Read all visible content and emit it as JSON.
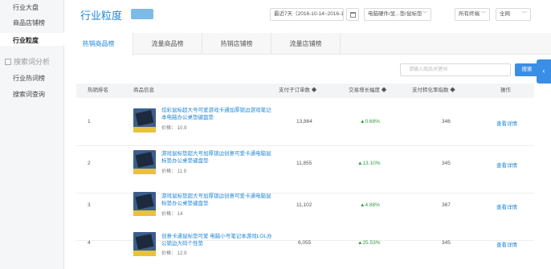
{
  "sidebar": {
    "items": [
      {
        "label": "行业大盘"
      },
      {
        "label": "商品店铺榜"
      },
      {
        "label": "行业粒度"
      }
    ],
    "group_label": "搜索词分析",
    "sub_items": [
      {
        "label": "行业热词榜"
      },
      {
        "label": "搜索词查询"
      }
    ]
  },
  "header": {
    "title": "行业粒度",
    "badge": "",
    "date_range": "最近7天（2016-10-14~2016-10-20）",
    "category": "电脑硬件/显...垫/鼠标垫",
    "terminal": "所有终端",
    "filter": "全网"
  },
  "tabs": [
    {
      "label": "热销商品榜"
    },
    {
      "label": "流量商品榜"
    },
    {
      "label": "热销店铺榜"
    },
    {
      "label": "流量店铺榜"
    }
  ],
  "search": {
    "placeholder": "请输入商品关键词",
    "button": "搜索"
  },
  "table": {
    "headers": {
      "rank": "热销排名",
      "info": "商品信息",
      "orders": "支付子订单数 ◆",
      "growth": "交易增长幅度 ◆",
      "conversion": "支付转化率指数 ◆",
      "action": "操作"
    },
    "rows": [
      {
        "rank": "1",
        "name": "炫彩鼠标超大号可爱游戏卡通加厚锁边游戏笔记本电脑办公桌垫键盘垫",
        "price": "价格： 10.9",
        "orders": "13,864",
        "growth": "0.68%",
        "conversion": "346",
        "action": "查看详情"
      },
      {
        "rank": "2",
        "name": "游戏鼠标垫超大号加厚锁边创意可爱卡通电脑鼠标垫办公桌垫键盘垫",
        "price": "价格： 11.9",
        "orders": "11,855",
        "growth": "13.10%",
        "conversion": "345",
        "action": "查看详情"
      },
      {
        "rank": "3",
        "name": "游戏鼠标垫超大号加厚锁边创意可爱卡通电脑鼠标垫办公桌垫键盘垫",
        "price": "价格： 14",
        "orders": "11,102",
        "growth": "4.88%",
        "conversion": "367",
        "action": "查看详情"
      },
      {
        "rank": "4",
        "name": "创意卡通鼠标垫可爱 电脑小号笔记本游戏LOL办公锁边大码个性垫",
        "price": "价格： 12.9",
        "orders": "6,055",
        "growth": "25.53%",
        "conversion": "345",
        "action": "查看详情"
      }
    ]
  }
}
